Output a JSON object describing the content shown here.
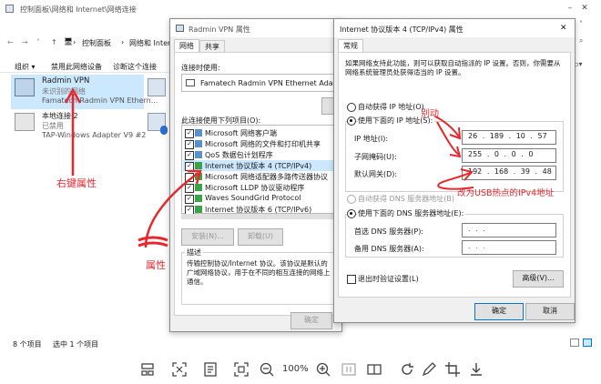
{
  "explorer": {
    "breadcrumb_title": "控制面板\\网络和 Internet\\网络连接",
    "address": [
      "控制面板",
      "网络和 Internet"
    ],
    "menu": [
      "组织 ▾",
      "禁用此网络设备",
      "诊断这个连接"
    ],
    "adapters": [
      {
        "name": "Radmin VPN",
        "status": "未识别的网络",
        "device": "Famatech Radmin VPN Ethern..."
      },
      {
        "name": "本地连接 2",
        "status": "已禁用",
        "device": "TAP-Windows Adapter V9 #2"
      }
    ],
    "status_left": "8 个项目",
    "status_right": "选中 1 个项目"
  },
  "props": {
    "title": "Radmin VPN 属性",
    "tabs": [
      "网络",
      "共享"
    ],
    "connect_using": "连接时使用:",
    "adapter": "Famatech Radmin VPN Ethernet Adapter",
    "items_label": "此连接使用下列项目(O):",
    "items": [
      {
        "label": "Microsoft 网络客户端",
        "checked": true
      },
      {
        "label": "Microsoft 网络的文件和打印机共享",
        "checked": true
      },
      {
        "label": "QoS 数据包计划程序",
        "checked": true
      },
      {
        "label": "Internet 协议版本 4 (TCP/IPv4)",
        "checked": true
      },
      {
        "label": "Microsoft 网络适配器多路传送器协议",
        "checked": false
      },
      {
        "label": "Microsoft LLDP 协议驱动程序",
        "checked": true
      },
      {
        "label": "Waves SoundGrid Protocol",
        "checked": true
      },
      {
        "label": "Internet 协议版本 6 (TCP/IPv6)",
        "checked": true
      }
    ],
    "install": "安装(N)...",
    "uninstall": "卸载(U)",
    "desc_label": "描述",
    "desc": "传输控制协议/Internet 协议。该协议是默认的广域网络协议，用于在不同的相互连接的网络上通信。",
    "ok": "确定"
  },
  "ipv4": {
    "title": "Internet 协议版本 4 (TCP/IPv4) 属性",
    "tab": "常规",
    "intro": "如果网络支持此功能，则可以获取自动指派的 IP 设置。否则，你需要从网络系统管理员处获得适当的 IP 设置。",
    "auto_ip": "自动获得 IP 地址(O)",
    "manual_ip": "使用下面的 IP 地址(S):",
    "ip_label": "IP 地址(I):",
    "ip": "26 . 189 . 10 . 57",
    "mask_label": "子网掩码(U):",
    "mask": "255 . 0 . 0 . 0",
    "gw_label": "默认网关(D):",
    "gw": "192 . 168 . 39 . 48",
    "auto_dns": "自动获得 DNS 服务器地址(B)",
    "manual_dns": "使用下面的 DNS 服务器地址(E):",
    "dns1_label": "首选 DNS 服务器(P):",
    "dns2_label": "备用 DNS 服务器(A):",
    "dns_empty": ".     .     .",
    "validate": "退出时验证设置(L)",
    "advanced": "高级(V)...",
    "ok": "确定",
    "cancel": "取消"
  },
  "annotations": {
    "right_click": "右键属性",
    "props": "属性",
    "change": "别动",
    "usb_hotspot": "改为USB热点的IPv4地址"
  },
  "viewer": {
    "zoom": "100%"
  },
  "colors": {
    "annotation": "#e8262b",
    "accent": "#0078d7"
  }
}
